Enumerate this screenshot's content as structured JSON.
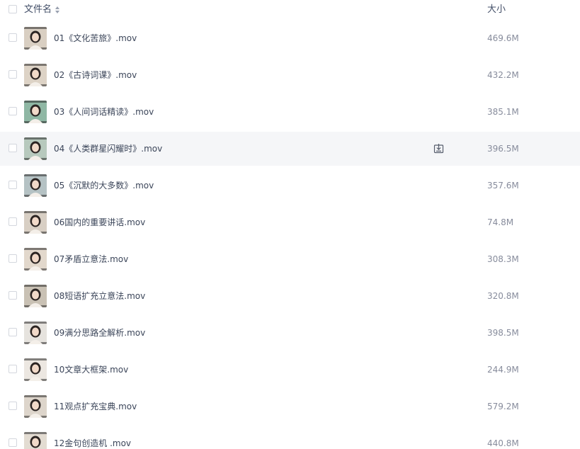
{
  "header": {
    "name_label": "文件名",
    "size_label": "大小"
  },
  "files": [
    {
      "name": "01《文化苦旅》.mov",
      "size": "469.6M",
      "thumb_bg": "#d9cfc2"
    },
    {
      "name": "02《古诗词课》.mov",
      "size": "432.2M",
      "thumb_bg": "#ddd3c6"
    },
    {
      "name": "03《人间词话精读》.mov",
      "size": "385.1M",
      "thumb_bg": "#8fb7a4"
    },
    {
      "name": "04《人类群星闪耀时》.mov",
      "size": "396.5M",
      "thumb_bg": "#b7c9bd"
    },
    {
      "name": "05《沉默的大多数》.mov",
      "size": "357.6M",
      "thumb_bg": "#b5c2c4"
    },
    {
      "name": "06国内的重要讲话.mov",
      "size": "74.8M",
      "thumb_bg": "#d8cfc4"
    },
    {
      "name": "07矛盾立意法.mov",
      "size": "308.3M",
      "thumb_bg": "#e2d8cc"
    },
    {
      "name": "08短语扩充立意法.mov",
      "size": "320.8M",
      "thumb_bg": "#c9c1b4"
    },
    {
      "name": "09满分思路全解析.mov",
      "size": "398.5M",
      "thumb_bg": "#e6e3de"
    },
    {
      "name": "10文章大框架.mov",
      "size": "244.9M",
      "thumb_bg": "#ece7e1"
    },
    {
      "name": "11观点扩充宝典.mov",
      "size": "579.2M",
      "thumb_bg": "#ddd5cb"
    },
    {
      "name": "12金句创造机 .mov",
      "size": "440.8M",
      "thumb_bg": "#e3dcd2"
    }
  ],
  "hovered_index": 3,
  "icons": {
    "sort": "sort-icon",
    "download": "download-icon",
    "checkbox": "checkbox"
  }
}
